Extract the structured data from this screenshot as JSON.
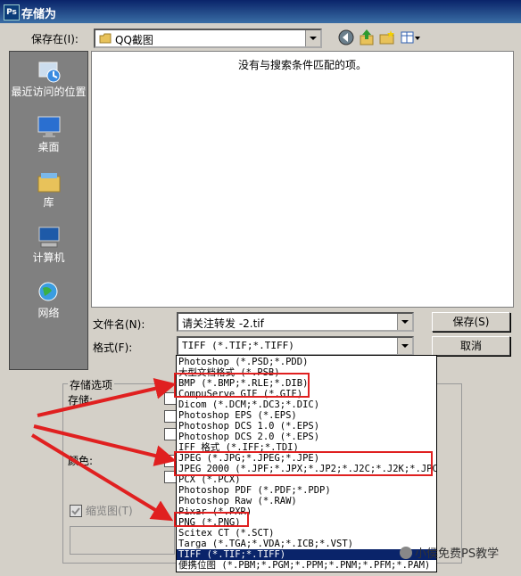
{
  "window": {
    "title": "存储为",
    "app_icon": "Ps"
  },
  "save_in": {
    "label": "保存在(I):",
    "value": "QQ截图"
  },
  "toolbar": {
    "icons": [
      "back-icon",
      "up-folder-icon",
      "new-folder-icon",
      "view-menu-icon"
    ]
  },
  "places": [
    {
      "label": "最近访问的位置",
      "icon": "recent-icon"
    },
    {
      "label": "桌面",
      "icon": "desktop-icon"
    },
    {
      "label": "库",
      "icon": "library-icon"
    },
    {
      "label": "计算机",
      "icon": "computer-icon"
    },
    {
      "label": "网络",
      "icon": "network-icon"
    }
  ],
  "file_list": {
    "empty_message": "没有与搜索条件匹配的项。"
  },
  "filename": {
    "label": "文件名(N):",
    "value": "请关注转发 -2.tif"
  },
  "format": {
    "label": "格式(F):",
    "value": "TIFF (*.TIF;*.TIFF)"
  },
  "buttons": {
    "save": "保存(S)",
    "cancel": "取消"
  },
  "options": {
    "group_title": "存储选项",
    "storage_label": "存储:",
    "color_label": "颜色:",
    "thumbnail_label": "缩览图(T)"
  },
  "format_options": [
    "Photoshop (*.PSD;*.PDD)",
    "大型文档格式 (*.PSB)",
    "BMP (*.BMP;*.RLE;*.DIB)",
    "CompuServe GIF (*.GIF)",
    "Dicom (*.DCM;*.DC3;*.DIC)",
    "Photoshop EPS (*.EPS)",
    "Photoshop DCS 1.0 (*.EPS)",
    "Photoshop DCS 2.0 (*.EPS)",
    "IFF 格式 (*.IFF;*.TDI)",
    "JPEG (*.JPG;*.JPEG;*.JPE)",
    "JPEG 2000 (*.JPF;*.JPX;*.JP2;*.J2C;*.J2K;*.JPC)",
    "PCX (*.PCX)",
    "Photoshop PDF (*.PDF;*.PDP)",
    "Photoshop Raw (*.RAW)",
    "Pixar (*.PXR)",
    "PNG (*.PNG)",
    "Scitex CT (*.SCT)",
    "Targa (*.TGA;*.VDA;*.ICB;*.VST)",
    "TIFF (*.TIF;*.TIFF)",
    "便携位图 (*.PBM;*.PGM;*.PPM;*.PNM;*.PFM;*.PAM)"
  ],
  "selected_format_index": 18,
  "watermark": "小侯免费PS教学",
  "colors": {
    "title_bar": "#0a246a",
    "highlight": "#0a246a",
    "annotation": "#e02020"
  }
}
